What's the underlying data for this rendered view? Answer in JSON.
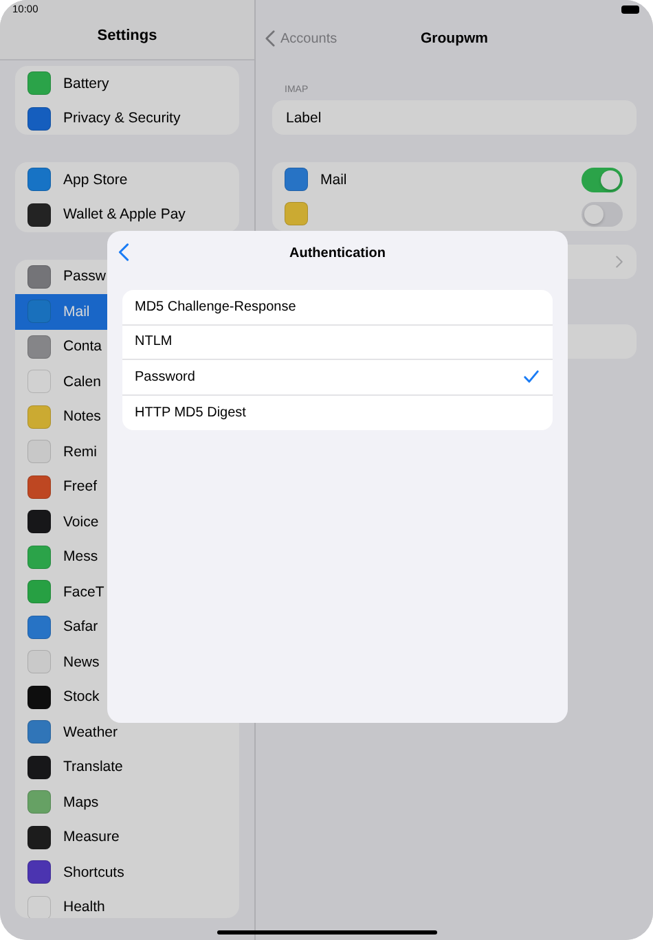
{
  "status_bar": {
    "time": "10:00"
  },
  "sidebar": {
    "title": "Settings",
    "groups": [
      {
        "items": [
          {
            "label": "Battery",
            "color": "#2ba349",
            "selected": false
          },
          {
            "label": "Privacy & Security",
            "color": "#155ebe",
            "selected": false
          }
        ]
      },
      {
        "items": [
          {
            "label": "App Store",
            "color": "#1773c5",
            "selected": false
          },
          {
            "label": "Wallet & Apple Pay",
            "color": "#232323",
            "selected": false
          }
        ]
      },
      {
        "items": [
          {
            "label": "Passw",
            "color": "#747478",
            "selected": false
          },
          {
            "label": "Mail",
            "color": "#1970bc",
            "selected": true
          },
          {
            "label": "Conta",
            "color": "#858588",
            "selected": false
          },
          {
            "label": "Calen",
            "color": "#d1d1d1",
            "selected": false
          },
          {
            "label": "Notes",
            "color": "#cbaa32",
            "selected": false
          },
          {
            "label": "Remi",
            "color": "#c8c8c8",
            "selected": false
          },
          {
            "label": "Freef",
            "color": "#be4722",
            "selected": false
          },
          {
            "label": "Voice",
            "color": "#171719",
            "selected": false
          },
          {
            "label": "Mess",
            "color": "#2ba349",
            "selected": false
          },
          {
            "label": "FaceT",
            "color": "#27a043",
            "selected": false
          },
          {
            "label": "Safar",
            "color": "#2773c5",
            "selected": false
          },
          {
            "label": "News",
            "color": "#c9c9c9",
            "selected": false
          },
          {
            "label": "Stock",
            "color": "#0e0e0e",
            "selected": false
          },
          {
            "label": "Weather",
            "color": "#3075b8",
            "selected": false
          },
          {
            "label": "Translate",
            "color": "#171719",
            "selected": false
          },
          {
            "label": "Maps",
            "color": "#66a164",
            "selected": false
          },
          {
            "label": "Measure",
            "color": "#1c1c1c",
            "selected": false
          },
          {
            "label": "Shortcuts",
            "color": "#4b34b0",
            "selected": false
          },
          {
            "label": "Health",
            "color": "#d1d1d1",
            "selected": false
          }
        ]
      }
    ]
  },
  "detail": {
    "back": "Accounts",
    "title": "Groupwm",
    "section_header": "IMAP",
    "label_cell": "Label",
    "toggles": [
      {
        "label": "Mail",
        "color": "#2773c5",
        "on": true
      },
      {
        "color": "#cbaa32",
        "on": false
      }
    ]
  },
  "dialog": {
    "title": "Authentication",
    "options": [
      {
        "label": "MD5 Challenge-Response",
        "selected": false
      },
      {
        "label": "NTLM",
        "selected": false
      },
      {
        "label": "Password",
        "selected": true
      },
      {
        "label": "HTTP MD5 Digest",
        "selected": false
      }
    ]
  }
}
